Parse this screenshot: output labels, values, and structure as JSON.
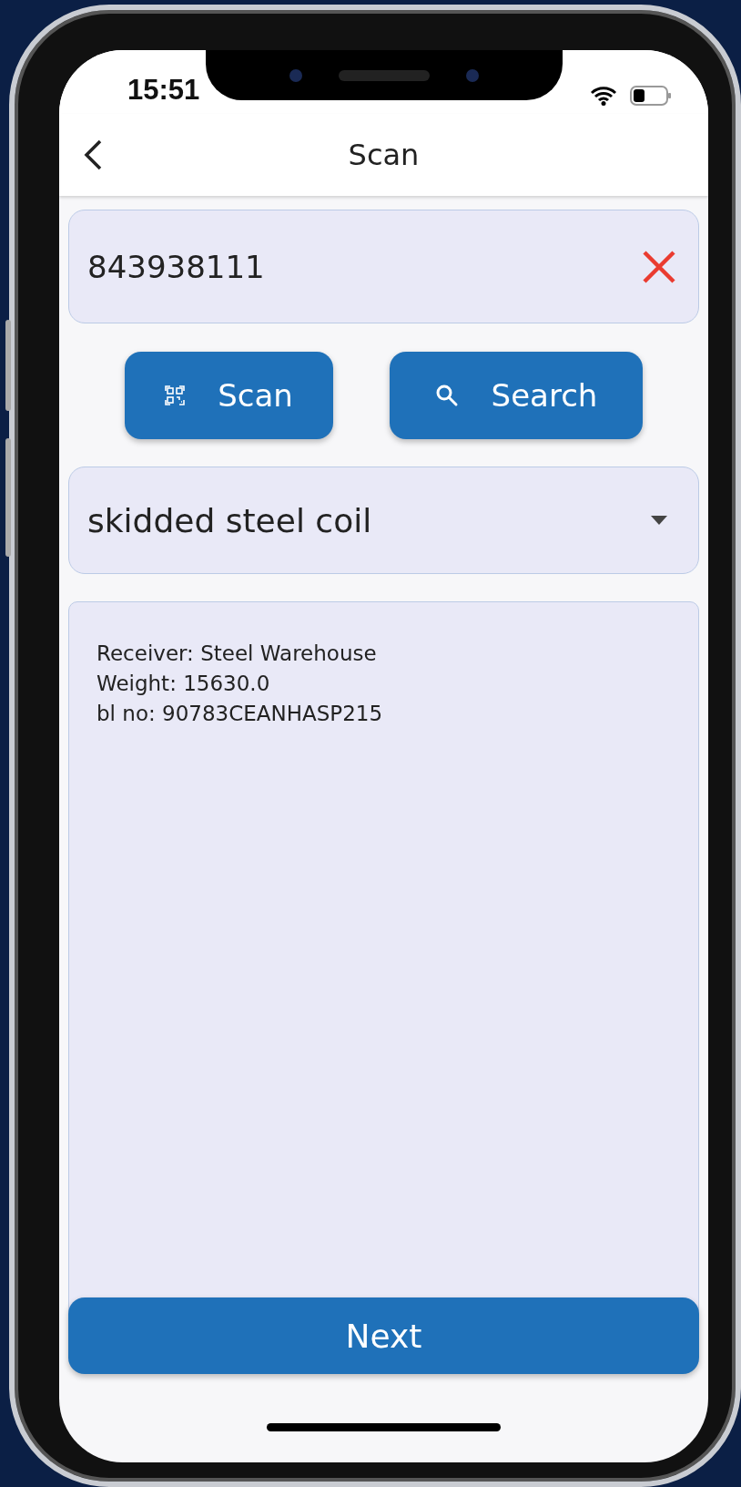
{
  "status_bar": {
    "time": "15:51"
  },
  "header": {
    "title": "Scan"
  },
  "search_field": {
    "value": "843938111"
  },
  "buttons": [
    {
      "label": "Scan",
      "kind": "scan"
    },
    {
      "label": "Search",
      "kind": "search"
    }
  ],
  "dropdown": {
    "value": "skidded steel coil"
  },
  "details": [
    "Receiver: Steel Warehouse",
    "Weight: 15630.0",
    "bl no: 90783CEANHASP215"
  ],
  "next_button": {
    "label": "Next"
  }
}
